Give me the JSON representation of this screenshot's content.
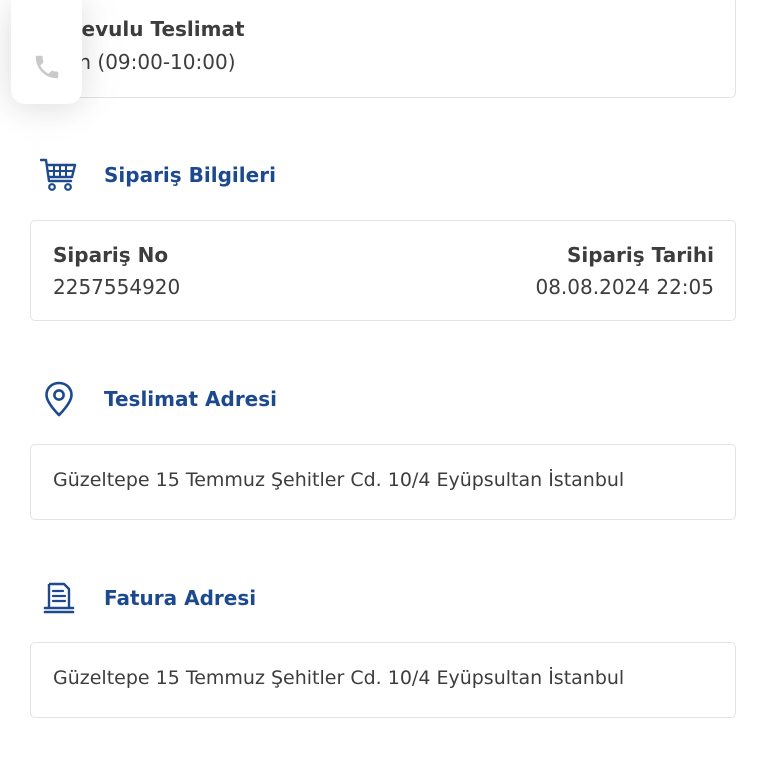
{
  "delivery": {
    "title": "ndevulu Teslimat",
    "time": "gün (09:00-10:00)"
  },
  "phone_button": {
    "icon": "phone-icon"
  },
  "order_section": {
    "title": "Sipariş Bilgileri",
    "icon": "cart-icon",
    "order_no_label": "Sipariş No",
    "order_no_value": "2257554920",
    "order_date_label": "Sipariş Tarihi",
    "order_date_value": "08.08.2024 22:05"
  },
  "delivery_address": {
    "title": "Teslimat Adresi",
    "icon": "location-pin-icon",
    "address": "Güzeltepe 15 Temmuz Şehitler Cd. 10/4 Eyüpsultan İstanbul"
  },
  "billing_address": {
    "title": "Fatura Adresi",
    "icon": "receipt-icon",
    "address": "Güzeltepe 15 Temmuz Şehitler Cd. 10/4 Eyüpsultan İstanbul"
  },
  "colors": {
    "accent": "#1d4a8e",
    "text": "#3d3d3d",
    "border": "#e3e3e3"
  }
}
